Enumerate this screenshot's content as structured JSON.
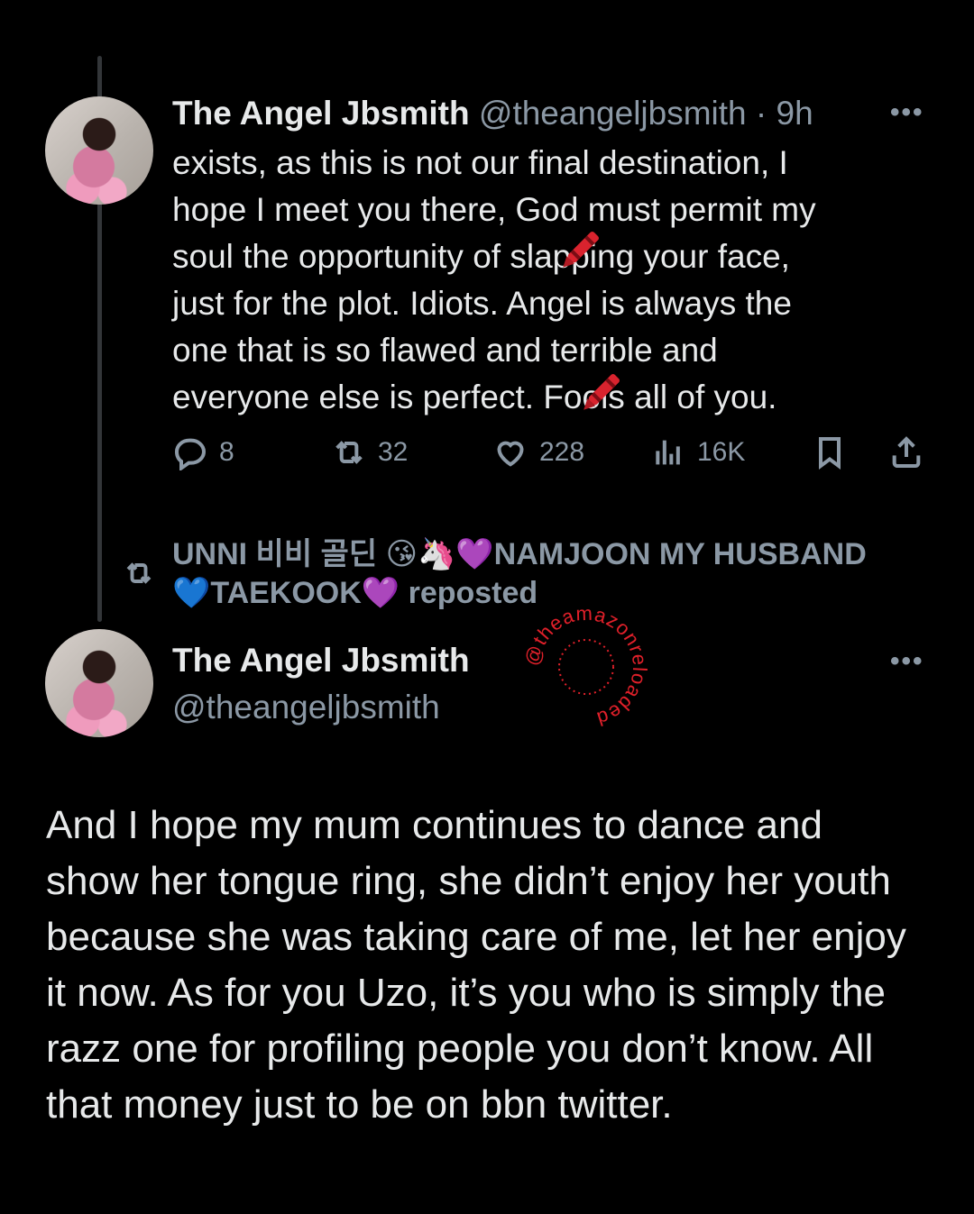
{
  "tweet1": {
    "name": "The Angel Jbsmith",
    "handle": "@theangeljbsmith",
    "time": "9h",
    "lines": [
      "exists, as this is not our final destination, I",
      "hope I meet you there, God must permit my",
      "soul the opportunity of slapping your face,",
      "just for the plot. Idiots. Angel is always the",
      "one that is so flawed and terrible and",
      "everyone else is perfect. Fools all of you."
    ],
    "stats": {
      "replies": "8",
      "reposts": "32",
      "likes": "228",
      "views": "16K"
    }
  },
  "repost": {
    "line1": "UNNI 비비 골딘 😘🦄💜NAMJOON MY HUSBAND",
    "line2": "💙TAEKOOK💜 reposted"
  },
  "tweet2": {
    "name": "The Angel Jbsmith",
    "handle": "@theangeljbsmith",
    "lines": [
      "And I hope my mum continues to dance and",
      "show her tongue ring, she didn’t enjoy her youth",
      "because she was taking care of me, let her enjoy",
      "it now. As for you Uzo, it’s you who is simply the",
      "razz one for profiling people you don’t know. All",
      "that money just to be on bbn twitter."
    ]
  },
  "watermark": "@theamazonreloaded",
  "icons": {
    "reply": "reply-icon",
    "repost": "repost-icon",
    "like": "heart-icon",
    "views": "views-icon",
    "bookmark": "bookmark-icon",
    "share": "share-icon",
    "more": "more-icon",
    "crayon": "crayon-emoji"
  },
  "colors": {
    "background": "#000000",
    "text": "#e7e9ea",
    "muted": "#8b98a5",
    "watermark": "#e0202a"
  }
}
